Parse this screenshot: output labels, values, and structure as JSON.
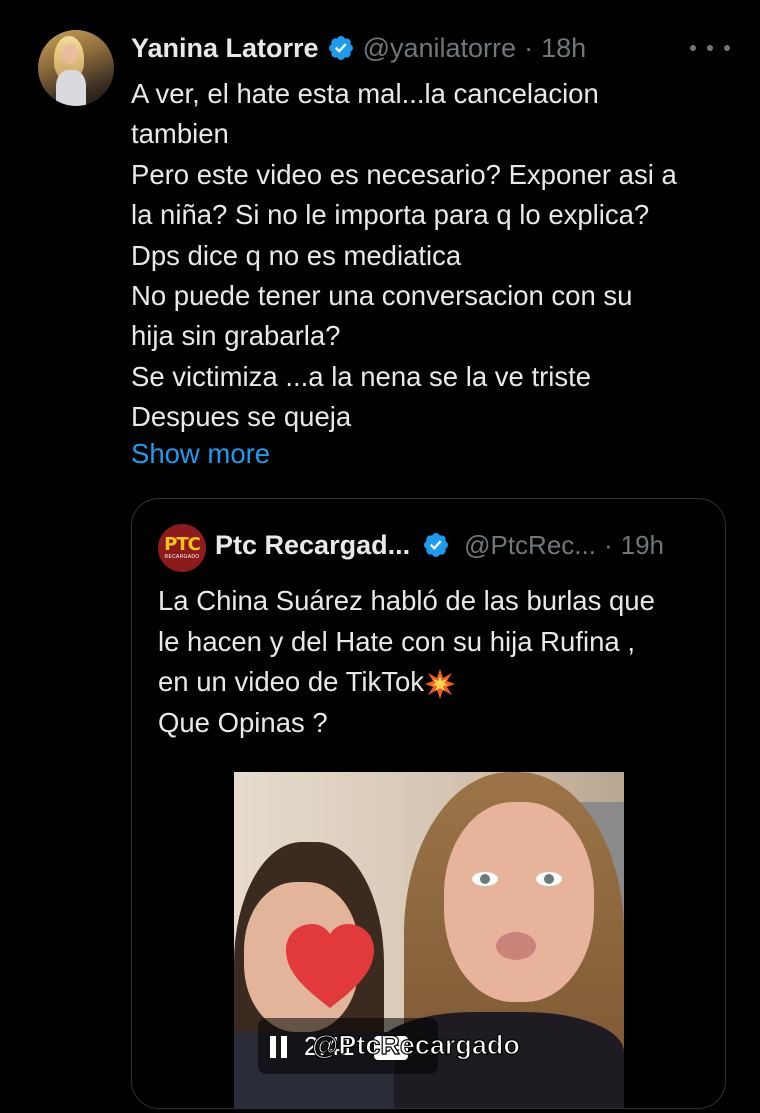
{
  "tweet": {
    "author_name": "Yanina Latorre",
    "author_handle": "@yanilatorre",
    "separator": "·",
    "time": "18h",
    "text_lines": [
      "A ver, el hate esta mal...la cancelacion",
      "tambien",
      "Pero este video es necesario? Exponer asi a",
      "la niña? Si no le importa para q lo explica?",
      "Dps dice q no es mediatica",
      "No puede tener una conversacion con su",
      "hija sin grabarla?",
      "Se victimiza ...a la nena se la ve triste",
      "Despues se queja"
    ],
    "show_more": "Show more"
  },
  "quote": {
    "avatar_logo": "PTC",
    "avatar_logo_sub": "RECARGADO",
    "author_name": "Ptc Recargad...",
    "author_handle": "@PtcRec...",
    "separator": "·",
    "time": "19h",
    "text_lines": [
      "La China Suárez habló de las burlas que",
      "le hacen y del Hate con su hija Rufina ,",
      "en un video de TikTok",
      "Que Opinas ?"
    ],
    "video": {
      "watermark": "@PtcRecargado",
      "time": "2:41",
      "cc_label": "CC"
    }
  },
  "colors": {
    "background": "#000000",
    "text": "#e7e9ea",
    "muted": "#71767b",
    "link": "#1d9bf0",
    "verified": "#1d9bf0",
    "border": "#2f3336"
  }
}
